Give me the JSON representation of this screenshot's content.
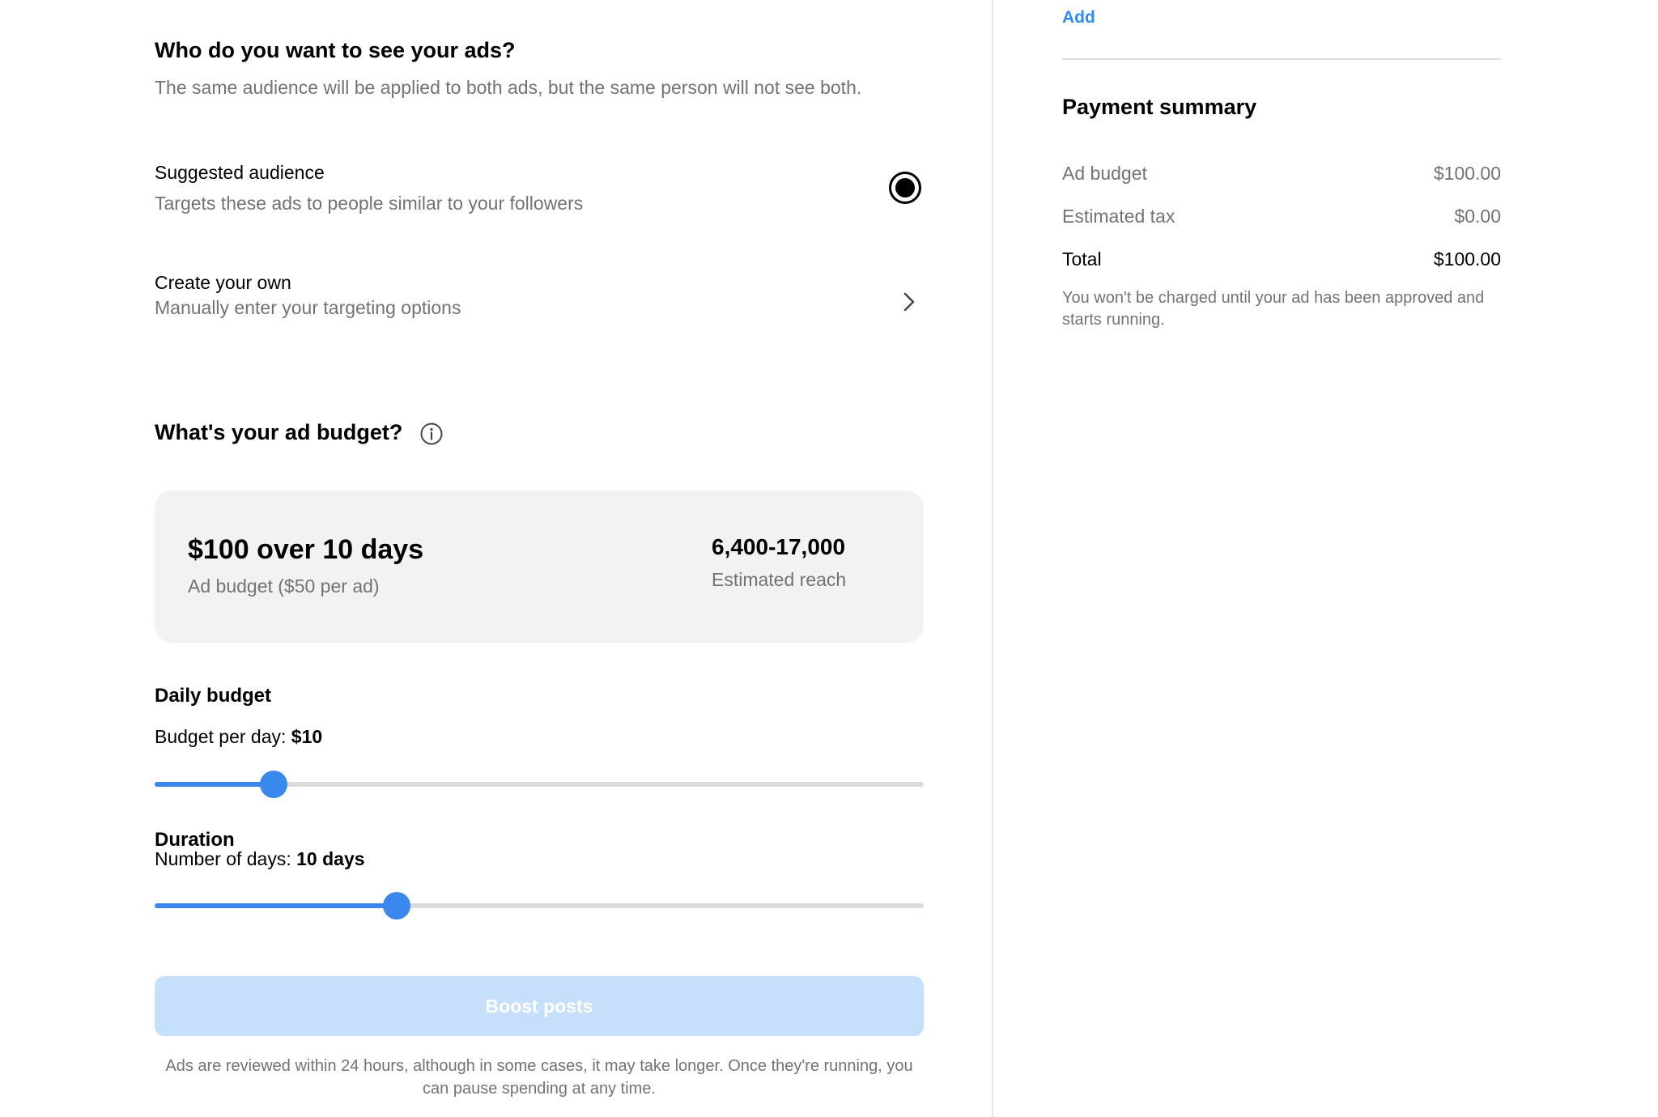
{
  "audience": {
    "title": "Who do you want to see your ads?",
    "description": "The same audience will be applied to both ads, but the same person will not see both.",
    "options": [
      {
        "title": "Suggested audience",
        "subtitle": "Targets these ads to people similar to your followers",
        "selected": true
      },
      {
        "title": "Create your own",
        "subtitle": "Manually enter your targeting options",
        "selected": false
      }
    ]
  },
  "budget": {
    "title": "What's your ad budget?",
    "info_icon": "info-circle-icon",
    "summary_main": "$100 over 10 days",
    "summary_sub": "Ad budget ($50 per ad)",
    "reach_value": "6,400-17,000",
    "reach_label": "Estimated reach"
  },
  "daily": {
    "label": "Daily budget",
    "prefix": "Budget per day: ",
    "value": "$10",
    "slider_fraction": 0.155
  },
  "duration": {
    "label": "Duration",
    "prefix": "Number of days: ",
    "value": "10 days",
    "slider_fraction": 0.315
  },
  "actions": {
    "boost_label": "Boost posts",
    "footnote": "Ads are reviewed within 24 hours, although in some cases, it may take longer. Once they're running, you can pause spending at any time."
  },
  "right": {
    "add_label": "Add",
    "payment_title": "Payment summary",
    "rows": [
      {
        "label": "Ad budget",
        "value": "$100.00"
      },
      {
        "label": "Estimated tax",
        "value": "$0.00"
      },
      {
        "label": "Total",
        "value": "$100.00"
      }
    ],
    "note": "You won't be charged until your ad has been approved and starts running."
  },
  "colors": {
    "accent": "#3a88ed",
    "link": "#2f8cf5",
    "disabled_button": "#c6dffa"
  }
}
